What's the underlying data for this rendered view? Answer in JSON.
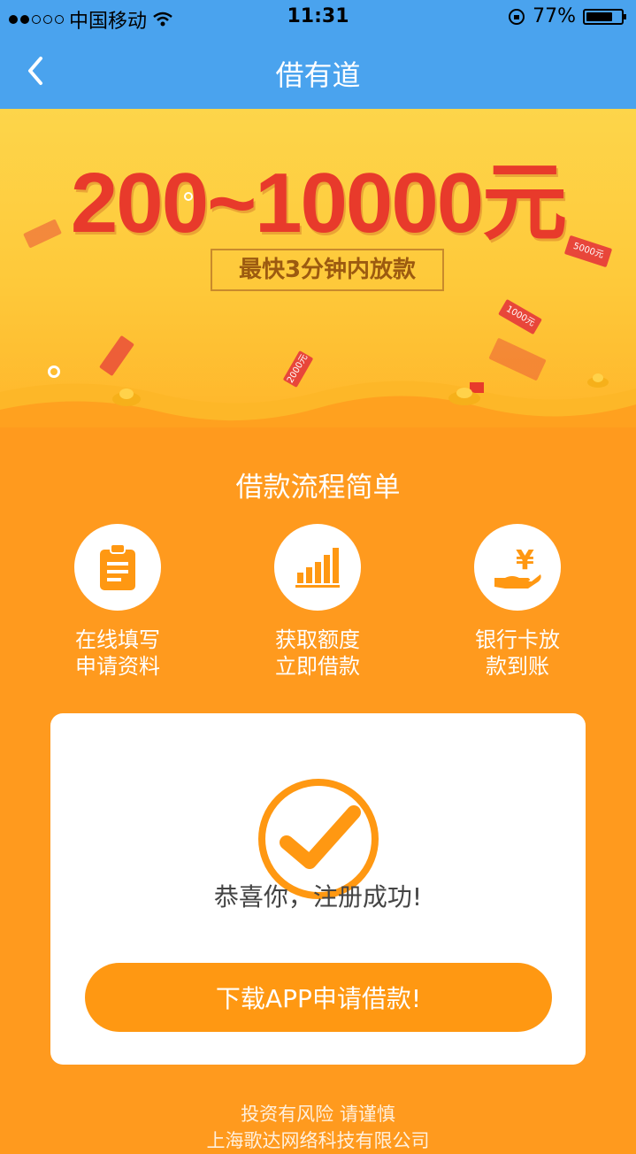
{
  "status": {
    "carrier": "中国移动",
    "time": "11:31",
    "battery": "77%",
    "battery_level": 0.77
  },
  "nav": {
    "title": "借有道"
  },
  "banner": {
    "amount": "200~10000元",
    "tag": "最快3分钟内放款",
    "bills": [
      "5000元",
      "1000元",
      "2000元"
    ]
  },
  "process": {
    "title": "借款流程简单",
    "steps": [
      {
        "line1": "在线填写",
        "line2": "申请资料",
        "icon": "clipboard-icon"
      },
      {
        "line1": "获取额度",
        "line2": "立即借款",
        "icon": "bar-chart-icon"
      },
      {
        "line1": "银行卡放",
        "line2": "款到账",
        "icon": "yen-hand-icon"
      }
    ]
  },
  "card": {
    "message": "恭喜你，注册成功!",
    "button": "下载APP申请借款!"
  },
  "footer": {
    "line1": "投资有风险 请谨慎",
    "line2": "上海歌达网络科技有限公司"
  },
  "colors": {
    "header_blue": "#4aa3ee",
    "orange": "#ff9812",
    "red": "#e83a2b"
  }
}
